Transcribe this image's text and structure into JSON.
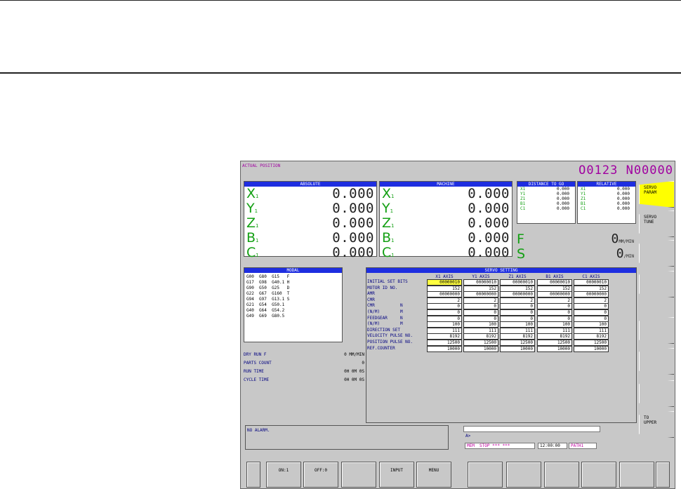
{
  "screen_title": "ACTUAL POSITION",
  "program": "O0123 N00000",
  "absolute": {
    "title": "ABSOLUTE",
    "axes": [
      {
        "name": "X",
        "sub": "1",
        "value": "0.000"
      },
      {
        "name": "Y",
        "sub": "1",
        "value": "0.000"
      },
      {
        "name": "Z",
        "sub": "1",
        "value": "0.000"
      },
      {
        "name": "B",
        "sub": "1",
        "value": "0.000"
      },
      {
        "name": "C",
        "sub": "1",
        "value": "0.000"
      }
    ]
  },
  "machine": {
    "title": "MACHINE",
    "axes": [
      {
        "name": "X",
        "sub": "1",
        "value": "0.000"
      },
      {
        "name": "Y",
        "sub": "1",
        "value": "0.000"
      },
      {
        "name": "Z",
        "sub": "1",
        "value": "0.000"
      },
      {
        "name": "B",
        "sub": "1",
        "value": "0.000"
      },
      {
        "name": "C",
        "sub": "1",
        "value": "0.000"
      }
    ]
  },
  "distance_to_go": {
    "title": "DISTANCE TO GO",
    "rows": [
      {
        "axis": "X1",
        "value": "0.000"
      },
      {
        "axis": "Y1",
        "value": "0.000"
      },
      {
        "axis": "Z1",
        "value": "0.000"
      },
      {
        "axis": "B1",
        "value": "0.000"
      },
      {
        "axis": "C1",
        "value": "0.000"
      }
    ]
  },
  "relative": {
    "title": "RELATIVE",
    "rows": [
      {
        "axis": "X1",
        "value": "0.000"
      },
      {
        "axis": "Y1",
        "value": "0.000"
      },
      {
        "axis": "Z1",
        "value": "0.000"
      },
      {
        "axis": "B1",
        "value": "0.000"
      },
      {
        "axis": "C1",
        "value": "0.000"
      }
    ]
  },
  "feed": {
    "letter": "F",
    "value": "0",
    "unit": "MM/MIN"
  },
  "spindle": {
    "letter": "S",
    "value": "0",
    "unit": "/MIN"
  },
  "modal": {
    "title": "MODAL",
    "lines": [
      "G00  G80  G15   F",
      "G17  G98  G40.1 H",
      "G90  G50  G25   D",
      "G22  G67  G160  T",
      "G94  G97  G13.1 S",
      "G21  G54  G50.1",
      "G40  G64  G54.2",
      "G49  G69  G80.5"
    ]
  },
  "run_info": [
    {
      "label": "DRY RUN F",
      "value": "0 MM/MIN"
    },
    {
      "label": "PARTS COUNT",
      "value": "0"
    },
    {
      "label": "RUN TIME",
      "value": "0H 0M 0S"
    },
    {
      "label": "CYCLE TIME",
      "value": "0H 0M 0S"
    }
  ],
  "servo": {
    "title": "SERVO SETTING",
    "columns": [
      "X1 AXIS",
      "Y1 AXIS",
      "Z1 AXIS",
      "B1 AXIS",
      "C1 AXIS"
    ],
    "rows": [
      {
        "label": "INITIAL SET BITS",
        "values": [
          "00000010",
          "00000010",
          "00000010",
          "00000010",
          "00000010"
        ]
      },
      {
        "label": "MOTOR ID NO.",
        "values": [
          "152",
          "152",
          "152",
          "152",
          "152"
        ]
      },
      {
        "label": "AMR",
        "values": [
          "00000000",
          "00000000",
          "00000000",
          "00000000",
          "00000000"
        ]
      },
      {
        "label": "CMR",
        "values": [
          "2",
          "2",
          "2",
          "2",
          "2"
        ]
      },
      {
        "label": "CMR          N",
        "values": [
          "0",
          "0",
          "0",
          "0",
          "0"
        ]
      },
      {
        "label": "(N/M)        M",
        "values": [
          "0",
          "0",
          "0",
          "0",
          "0"
        ]
      },
      {
        "label": "FEEDGEAR     N",
        "values": [
          "0",
          "0",
          "0",
          "0",
          "0"
        ]
      },
      {
        "label": "(N/M)        M",
        "values": [
          "100",
          "100",
          "100",
          "100",
          "100"
        ]
      },
      {
        "label": "DIRECTION SET",
        "values": [
          "111",
          "111",
          "111",
          "111",
          "111"
        ]
      },
      {
        "label": "VELOCITY PULSE NO.",
        "values": [
          "8192",
          "8192",
          "8192",
          "8192",
          "8192"
        ]
      },
      {
        "label": "POSITION PULSE NO.",
        "values": [
          "12500",
          "12500",
          "12500",
          "12500",
          "12500"
        ]
      },
      {
        "label": "REF.COUNTER",
        "values": [
          "10000",
          "10000",
          "10000",
          "10000",
          "10000"
        ]
      }
    ]
  },
  "side_buttons": [
    {
      "label": "SERVO\nPARAM",
      "active": true
    },
    {
      "label": "SERVO\nTUNE",
      "active": false
    },
    {
      "label": "",
      "active": false
    },
    {
      "label": "",
      "active": false
    },
    {
      "label": "",
      "active": false
    },
    {
      "label": "",
      "active": false
    },
    {
      "label": "",
      "active": false
    },
    {
      "label": "TO\nUPPER",
      "active": false
    }
  ],
  "alarm_message": "NO ALARM.",
  "input_prompt": "A>",
  "status": {
    "mode": "MEM  STOP *** ***",
    "time": "12:00:00",
    "path": "PATH1"
  },
  "soft_keys": [
    "",
    "ON:1",
    "OFF:0",
    "",
    "INPUT",
    "MENU",
    "",
    "",
    "",
    "",
    ""
  ]
}
